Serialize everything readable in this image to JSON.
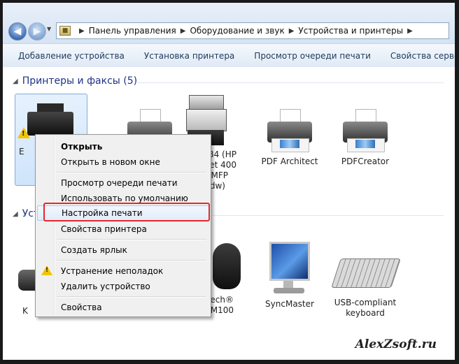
{
  "address": {
    "breadcrumbs": [
      "Панель управления",
      "Оборудование и звук",
      "Устройства и принтеры"
    ]
  },
  "toolbar": {
    "add_device": "Добавление устройства",
    "install_printer": "Установка принтера",
    "view_queue": "Просмотр очереди печати",
    "server_props": "Свойства сервера печати"
  },
  "groups": {
    "printers": "Принтеры и факсы (5)",
    "devices_partial": "Уст"
  },
  "printers": [
    {
      "name": "E"
    },
    {
      "name": ""
    },
    {
      "name_lines": [
        "B4 (HP",
        "et 400",
        "MFP",
        "dw)"
      ]
    },
    {
      "name": "PDF Architect"
    },
    {
      "name": "PDFCreator"
    }
  ],
  "devices": [
    {
      "name": "K"
    },
    {
      "name_lines": [
        "ech®",
        "M100"
      ]
    },
    {
      "name": "SyncMaster"
    },
    {
      "name_lines": [
        "USB-compliant",
        "keyboard"
      ]
    }
  ],
  "context_menu": {
    "open": "Открыть",
    "open_new_window": "Открыть в новом окне",
    "view_queue": "Просмотр очереди печати",
    "set_default": "Использовать по умолчанию",
    "print_prefs": "Настройка печати",
    "printer_props": "Свойства принтера",
    "create_shortcut": "Создать ярлык",
    "troubleshoot": "Устранение неполадок",
    "remove_device": "Удалить устройство",
    "properties": "Свойства"
  },
  "watermark": "AlexZsoft.ru",
  "colors": {
    "highlight": "#e2292e",
    "group_header": "#1e3287",
    "warning": "#f2c400"
  }
}
